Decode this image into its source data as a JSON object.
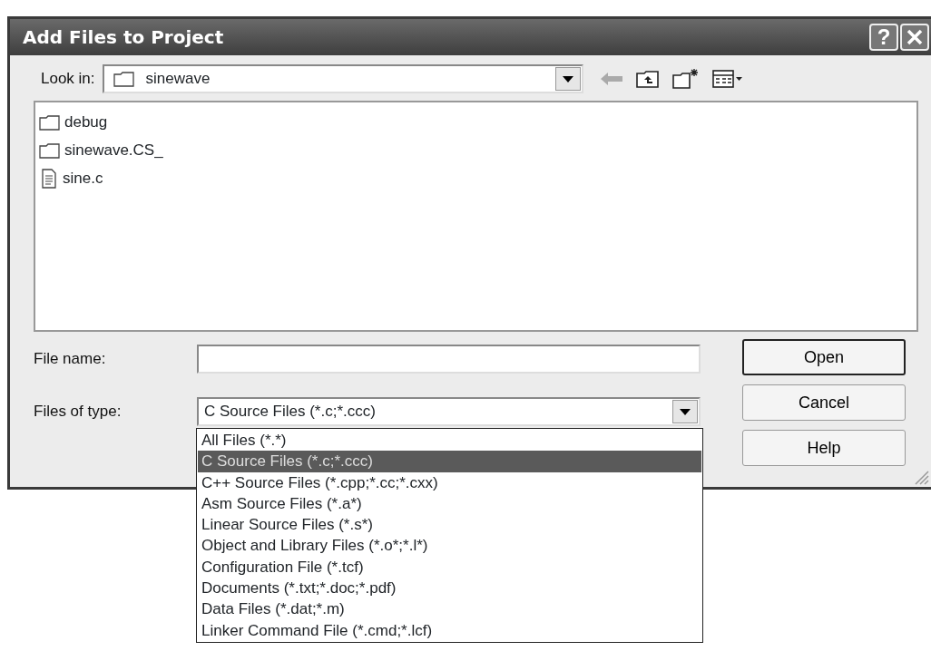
{
  "window": {
    "title": "Add Files to Project",
    "help_button": "?"
  },
  "look_in": {
    "label": "Look in:",
    "value": "sinewave"
  },
  "toolbar": [
    {
      "kind": "back",
      "disabled": true
    },
    {
      "kind": "up",
      "disabled": false
    },
    {
      "kind": "new-folder",
      "disabled": false
    },
    {
      "kind": "views",
      "disabled": false
    }
  ],
  "files": [
    {
      "name": "debug",
      "kind": "folder"
    },
    {
      "name": "sinewave.CS_",
      "kind": "folder"
    },
    {
      "name": "sine.c",
      "kind": "file"
    }
  ],
  "file_name": {
    "label": "File name:"
  },
  "files_of_type": {
    "label": "Files of type:",
    "value": "C Source Files (*.c;*.ccc)",
    "expanded": true,
    "options": [
      {
        "label": "All Files (*.*)",
        "selected": false
      },
      {
        "label": "C Source Files (*.c;*.ccc)",
        "selected": true
      },
      {
        "label": "C++ Source Files (*.cpp;*.cc;*.cxx)",
        "selected": false
      },
      {
        "label": "Asm Source Files (*.a*)",
        "selected": false
      },
      {
        "label": "Linear Source Files (*.s*)",
        "selected": false
      },
      {
        "label": "Object and Library Files (*.o*;*.l*)",
        "selected": false
      },
      {
        "label": "Configuration File (*.tcf)",
        "selected": false
      },
      {
        "label": "Documents (*.txt;*.doc;*.pdf)",
        "selected": false
      },
      {
        "label": "Data Files (*.dat;*.m)",
        "selected": false
      },
      {
        "label": "Linker Command File (*.cmd;*.lcf)",
        "selected": false
      }
    ]
  },
  "buttons": [
    {
      "label": "Open",
      "default": true
    },
    {
      "label": "Cancel",
      "default": false
    },
    {
      "label": "Help",
      "default": false
    }
  ]
}
